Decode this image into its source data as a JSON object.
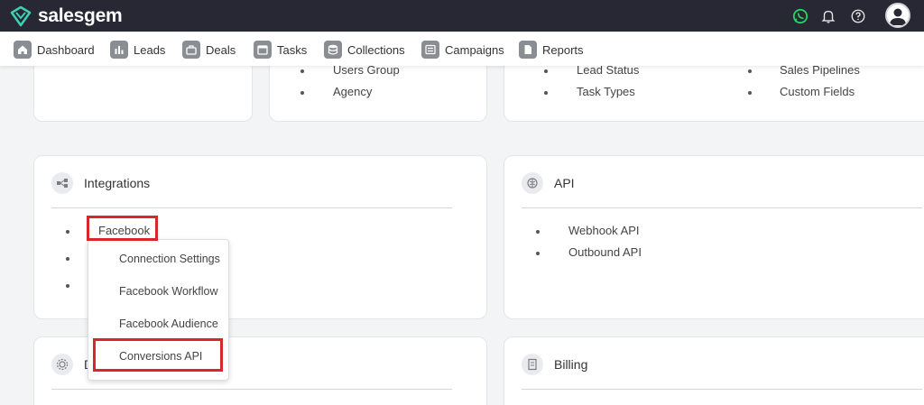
{
  "app": {
    "name": "salesgem"
  },
  "nav": {
    "items": [
      {
        "label": "Dashboard",
        "icon": "home-icon"
      },
      {
        "label": "Leads",
        "icon": "bar-chart-icon"
      },
      {
        "label": "Deals",
        "icon": "briefcase-icon"
      },
      {
        "label": "Tasks",
        "icon": "calendar-icon"
      },
      {
        "label": "Collections",
        "icon": "database-icon"
      },
      {
        "label": "Campaigns",
        "icon": "list-icon"
      },
      {
        "label": "Reports",
        "icon": "document-icon"
      }
    ]
  },
  "top_cards": {
    "middle": [
      "Users Group",
      "Agency"
    ],
    "right_col1": [
      "Lead Status",
      "Task Types"
    ],
    "right_col2": [
      "Sales Pipelines",
      "Custom Fields"
    ]
  },
  "integrations": {
    "title": "Integrations",
    "items": [
      "Facebook"
    ],
    "dropdown": [
      "Connection Settings",
      "Facebook Workflow",
      "Facebook Audience",
      "Conversions API"
    ]
  },
  "api": {
    "title": "API",
    "items": [
      "Webhook API",
      "Outbound API"
    ]
  },
  "bottom_cards": {
    "left_title_fragment": "D",
    "right_title": "Billing"
  },
  "colors": {
    "topbar": "#272833",
    "highlight": "#d9262b",
    "whatsapp": "#25d366"
  }
}
